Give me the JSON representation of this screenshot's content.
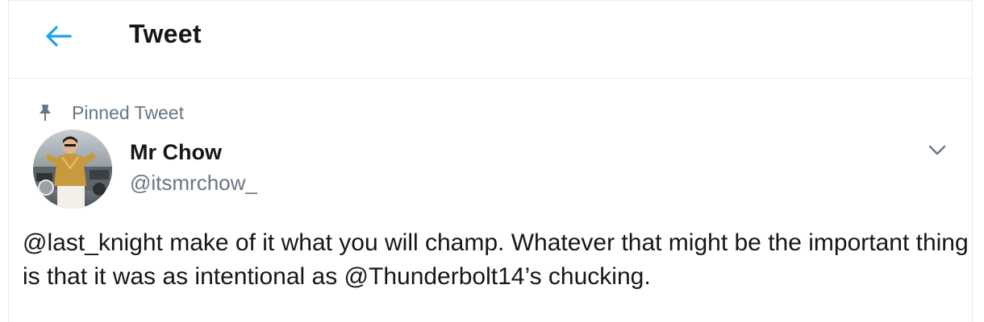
{
  "header": {
    "title": "Tweet",
    "back_icon": "arrow-left-icon",
    "accent_color": "#1da1f2"
  },
  "pinned": {
    "icon": "pin-icon",
    "label": "Pinned Tweet"
  },
  "tweet": {
    "author": {
      "name": "Mr Chow",
      "handle": "@itsmrchow_",
      "avatar": "profile-photo"
    },
    "caret_icon": "chevron-down-icon",
    "text": "@last_knight make of it what you will champ. Whatever that might be the important thing is that it was as intentional as @Thunderbolt14’s chucking."
  }
}
